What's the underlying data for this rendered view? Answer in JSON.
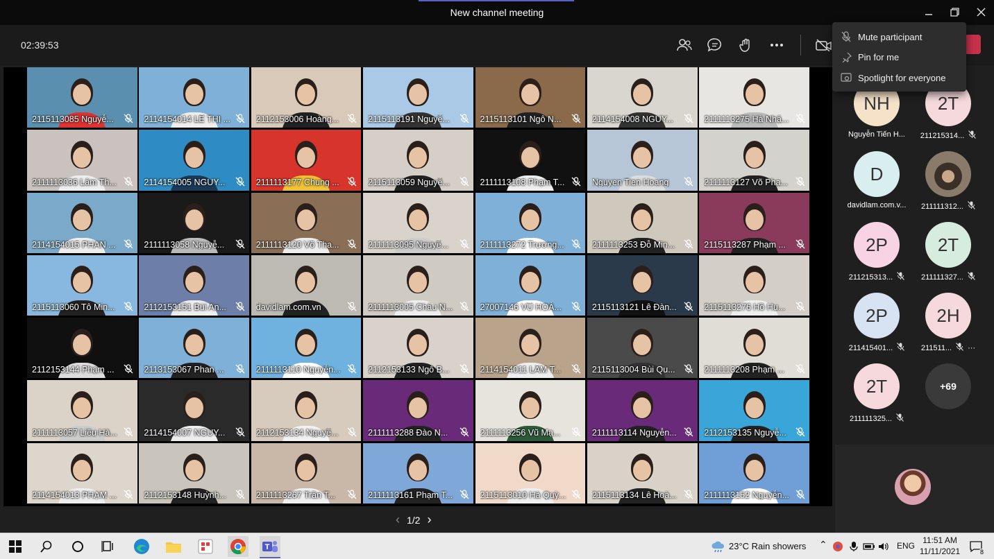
{
  "window": {
    "title": "New channel meeting"
  },
  "toolbar": {
    "timer": "02:39:53"
  },
  "tiles": [
    {
      "name": "2115113085 Nguyễ...",
      "bg": "#5a8fb0",
      "shirt": "#d33"
    },
    {
      "name": "2114154014 LÊ THỊ ...",
      "bg": "#7fb0d8",
      "shirt": "#eee"
    },
    {
      "name": "2112153006 Hoàng...",
      "bg": "#d8c9b8",
      "shirt": "#222"
    },
    {
      "name": "2115113191 Nguyễ...",
      "bg": "#a9c9e6",
      "shirt": "#333"
    },
    {
      "name": "2115113101 Ngô N...",
      "bg": "#8a6a4a",
      "shirt": "#222"
    },
    {
      "name": "2114154008 NGUY...",
      "bg": "#d9d6cf",
      "shirt": "#333"
    },
    {
      "name": "2111113275 Hà Nhậ...",
      "bg": "#e8e6e2",
      "shirt": "#bbb"
    },
    {
      "name": "2111113036 Lâm Th...",
      "bg": "#c9c2be",
      "shirt": "#eee"
    },
    {
      "name": "2114154005 NGUY...",
      "bg": "#2f8bc4",
      "shirt": "#1a3a5a"
    },
    {
      "name": "2111113177 Chung ...",
      "bg": "#d7342b",
      "shirt": "#f1c232"
    },
    {
      "name": "2115113059 Nguyễ...",
      "bg": "#d6cfc8",
      "shirt": "#222"
    },
    {
      "name": "2111113108 Phạm T...",
      "bg": "#111111",
      "shirt": "#eee"
    },
    {
      "name": "Nguyen Tien Hoang",
      "bg": "#b7c6d6",
      "shirt": "#dcdcdc"
    },
    {
      "name": "2111113127 Võ Phạ...",
      "bg": "#d4d2cc",
      "shirt": "#222"
    },
    {
      "name": "2114154015 PHAN ...",
      "bg": "#7aa9c9",
      "shirt": "#eee"
    },
    {
      "name": "2111113058 Nguyễ...",
      "bg": "#1a1a1a",
      "shirt": "#bbb"
    },
    {
      "name": "2111113120 Võ Tha...",
      "bg": "#8a6e55",
      "shirt": "#eee"
    },
    {
      "name": "2111113095 Nguyễ...",
      "bg": "#d9d3cc",
      "shirt": "#ccc"
    },
    {
      "name": "2111113272 Trương...",
      "bg": "#7fb0d8",
      "shirt": "#fff"
    },
    {
      "name": "2111113253 Đỗ Min...",
      "bg": "#cfc8bd",
      "shirt": "#222"
    },
    {
      "name": "2115113287 Phạm ...",
      "bg": "#8a3a5a",
      "shirt": "#222"
    },
    {
      "name": "2115113060 Tô Min...",
      "bg": "#88b8e0",
      "shirt": "#222"
    },
    {
      "name": "2112153151 Bùi An...",
      "bg": "#6d7fa8",
      "shirt": "#eee"
    },
    {
      "name": "davidlam.com.vn",
      "bg": "#bcbab3",
      "shirt": "#222"
    },
    {
      "name": "2111113005 Châu N...",
      "bg": "#cfcac2",
      "shirt": "#eee"
    },
    {
      "name": "27007146 VŨ HOÀ...",
      "bg": "#7fb0d8",
      "shirt": "#fff"
    },
    {
      "name": "2115113121 Lê Đàn...",
      "bg": "#2b3a4a",
      "shirt": "#111"
    },
    {
      "name": "2115113276 Hồ Hu...",
      "bg": "#d3cfc8",
      "shirt": "#eee"
    },
    {
      "name": "2112153144 Phạm ...",
      "bg": "#101010",
      "shirt": "#ddd"
    },
    {
      "name": "2113153067 Phan ...",
      "bg": "#7fb0d8",
      "shirt": "#222"
    },
    {
      "name": "2111113110 Nguyễn...",
      "bg": "#6fb2e0",
      "shirt": "#fff"
    },
    {
      "name": "2112153133 Ngô B...",
      "bg": "#d8d2ca",
      "shirt": "#222"
    },
    {
      "name": "2114154011 LÂM T...",
      "bg": "#b9a38a",
      "shirt": "#eee"
    },
    {
      "name": "2115113004 Bùi Qu...",
      "bg": "#4a4a4a",
      "shirt": "#333"
    },
    {
      "name": "2111113208 Phạm ...",
      "bg": "#e0dcd6",
      "shirt": "#222"
    },
    {
      "name": "2111113057 Liêu Hà...",
      "bg": "#dcd3c8",
      "shirt": "#ccc"
    },
    {
      "name": "2114154007 NGUY...",
      "bg": "#2a2a2a",
      "shirt": "#eee"
    },
    {
      "name": "2112153134 Nguyễ...",
      "bg": "#d7cbbd",
      "shirt": "#f2f2f2"
    },
    {
      "name": "2111113288 Đào N...",
      "bg": "#6a2a7a",
      "shirt": "#222"
    },
    {
      "name": "2111113256 Vũ Mạ...",
      "bg": "#e7e4de",
      "shirt": "#2e5a3a"
    },
    {
      "name": "2111113114 Nguyễn...",
      "bg": "#6a2a7a",
      "shirt": "#222"
    },
    {
      "name": "2112153135 Nguyễ...",
      "bg": "#3aa5d8",
      "shirt": "#222"
    },
    {
      "name": "2114154013 PHẠM ...",
      "bg": "#dcd6cc",
      "shirt": "#eee"
    },
    {
      "name": "2112153148 Huỳnh...",
      "bg": "#c9c5bd",
      "shirt": "#222"
    },
    {
      "name": "2111113267 Trần T...",
      "bg": "#c9b7a8",
      "shirt": "#f0f0f0"
    },
    {
      "name": "2111113161 Phạm T...",
      "bg": "#7fa8d8",
      "shirt": "#222"
    },
    {
      "name": "2115113010 Hà Quỳ...",
      "bg": "#f0d9c9",
      "shirt": "#eee"
    },
    {
      "name": "2115113134 Lê Hoà...",
      "bg": "#d8d2c8",
      "shirt": "#222"
    },
    {
      "name": "2111113152 Nguyễn...",
      "bg": "#6f9fd6",
      "shirt": "#fff"
    }
  ],
  "pager": {
    "label": "1/2",
    "prev": "‹",
    "next": "›"
  },
  "roster": [
    {
      "initials": "NH",
      "name": "Nguyễn Tiến H...",
      "color": "#f6e2c9",
      "muted": false
    },
    {
      "initials": "2T",
      "name": "211215314...",
      "color": "#f5d9dc",
      "muted": true
    },
    {
      "initials": "D",
      "name": "davidlam.com.v...",
      "color": "#d9eeee",
      "muted": false
    },
    {
      "initials": "",
      "name": "211111312...",
      "color": "#6a5a4a",
      "muted": true,
      "photo": true
    },
    {
      "initials": "2P",
      "name": "211215313...",
      "color": "#f7d3e3",
      "muted": true
    },
    {
      "initials": "2T",
      "name": "211111327...",
      "color": "#d6ecdf",
      "muted": true
    },
    {
      "initials": "2P",
      "name": "211415401...",
      "color": "#d7e3f2",
      "muted": true
    },
    {
      "initials": "2H",
      "name": "211511...",
      "color": "#f5d9dc",
      "muted": true,
      "more": true
    },
    {
      "initials": "2T",
      "name": "211111325...",
      "color": "#f5d9dc",
      "muted": true
    },
    {
      "initials": "+69",
      "name": "",
      "color": "#3a3a3a",
      "muted": false,
      "count": true
    }
  ],
  "menu": {
    "items": [
      {
        "label": "Mute participant",
        "icon": "mic-off-icon"
      },
      {
        "label": "Pin for me",
        "icon": "pin-icon"
      },
      {
        "label": "Spotlight for everyone",
        "icon": "spotlight-icon"
      }
    ]
  },
  "taskbar": {
    "weather": "23°C  Rain showers",
    "lang": "ENG",
    "time": "11:51 AM",
    "date": "11/11/2021",
    "notif_count": "8"
  }
}
